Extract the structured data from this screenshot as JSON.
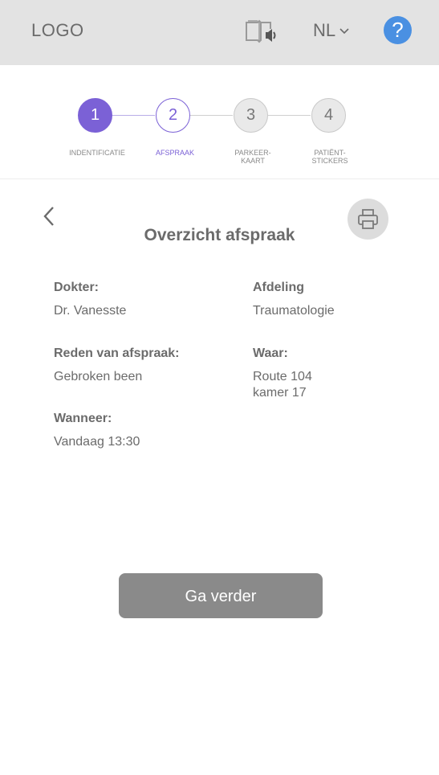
{
  "header": {
    "logo": "LOGO",
    "language": "NL",
    "help_symbol": "?",
    "icons": {
      "audio": "audio-book-icon",
      "lang": "chevron-down-icon",
      "help": "question-icon"
    }
  },
  "steps": [
    {
      "number": "1",
      "label": "INDENTIFICATIE",
      "state": "completed"
    },
    {
      "number": "2",
      "label": "AFSPRAAK",
      "state": "current"
    },
    {
      "number": "3",
      "label": "PARKEER-\nKAART",
      "state": "upcoming"
    },
    {
      "number": "4",
      "label": "PATIËNT-\nSTICKERS",
      "state": "upcoming"
    }
  ],
  "colors": {
    "accent": "#7b61d6",
    "help": "#4a90e2",
    "button": "#8a8a8a",
    "header": "#e3e3e3"
  },
  "page": {
    "title": "Overzicht afspraak"
  },
  "details": {
    "doctor_label": "Dokter:",
    "doctor_value": "Dr. Vanesste",
    "department_label": "Afdeling",
    "department_value": "Traumatologie",
    "reason_label": "Reden van afspraak:",
    "reason_value": "Gebroken been",
    "where_label": "Waar:",
    "where_line1": "Route 104",
    "where_line2": "kamer 17",
    "when_label": "Wanneer:",
    "when_value": "Vandaag 13:30"
  },
  "actions": {
    "continue": "Ga verder"
  }
}
